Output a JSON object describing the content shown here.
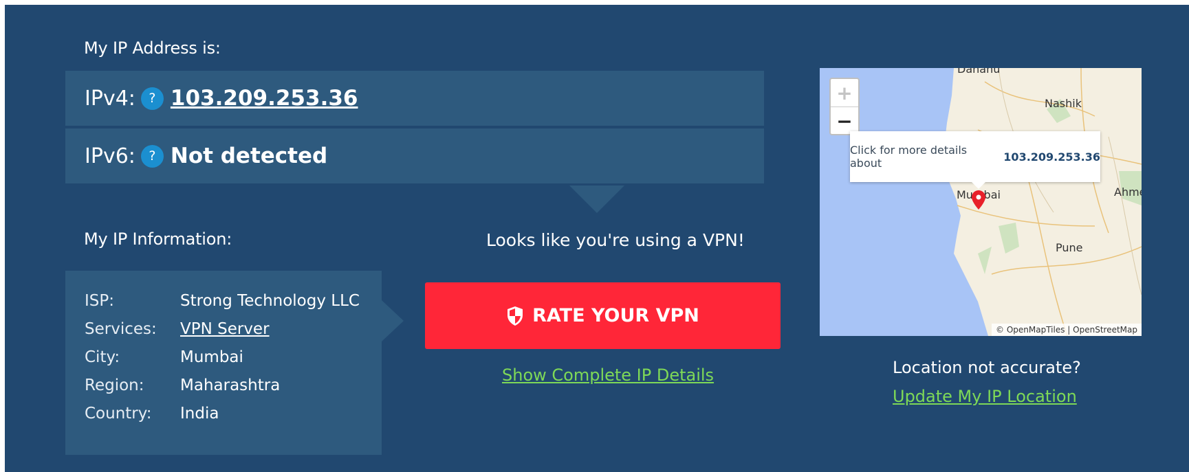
{
  "header": {
    "my_ip_label": "My IP Address is:"
  },
  "ip": {
    "v4_label": "IPv4:",
    "v4_value": "103.209.253.36",
    "v6_label": "IPv6:",
    "v6_value": "Not detected",
    "help_glyph": "?"
  },
  "info": {
    "title": "My IP Information:",
    "rows": [
      {
        "key": "ISP:",
        "value": "Strong Technology LLC"
      },
      {
        "key": "Services:",
        "value": "VPN Server"
      },
      {
        "key": "City:",
        "value": "Mumbai"
      },
      {
        "key": "Region:",
        "value": "Maharashtra"
      },
      {
        "key": "Country:",
        "value": "India"
      }
    ]
  },
  "vpn": {
    "message": "Looks like you're using a VPN!",
    "rate_button": "RATE YOUR VPN",
    "show_details": "Show Complete IP Details"
  },
  "map": {
    "zoom_in": "+",
    "zoom_out": "−",
    "popup_text": "Click for more details about",
    "popup_ip": "103.209.253.36",
    "cities": {
      "top": "Dahanu",
      "nashik": "Nashik",
      "mumbai": "Mumbai",
      "ahmednagar": "Ahme",
      "pune": "Pune"
    },
    "attribution": "© OpenMapTiles | OpenStreetMap"
  },
  "location": {
    "question": "Location not accurate?",
    "update_link": "Update My IP Location"
  },
  "colors": {
    "panel_bg": "#214870",
    "row_bg": "#2e5a7e",
    "accent_red": "#ff2638",
    "link_green": "#7ed957",
    "help_blue": "#1b8fd0",
    "sea": "#a8c4f6"
  },
  "icons": {
    "help": "question-circle-icon",
    "shield": "shield-icon",
    "marker": "map-marker-icon"
  }
}
